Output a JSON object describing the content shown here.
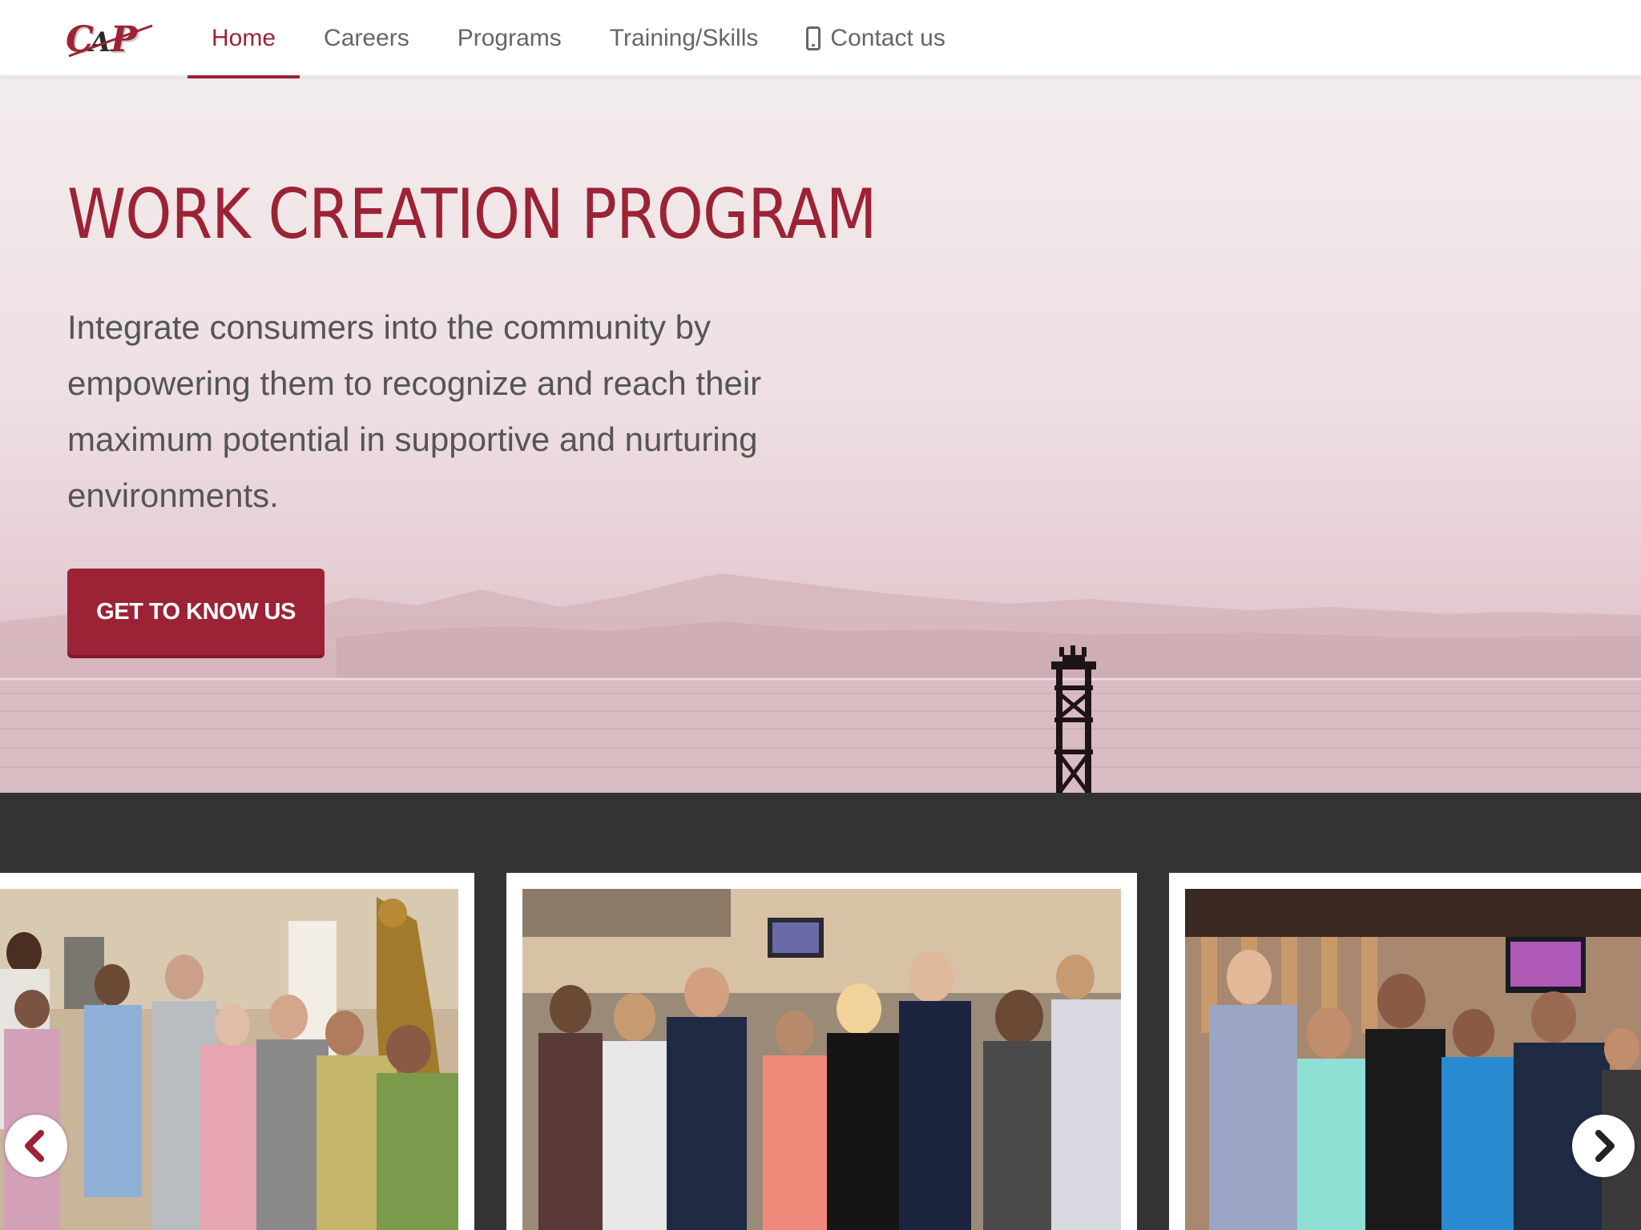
{
  "logo": {
    "text": "CAP",
    "icon": "cap-logo"
  },
  "nav": {
    "items": [
      {
        "label": "Home",
        "active": true
      },
      {
        "label": "Careers",
        "active": false
      },
      {
        "label": "Programs",
        "active": false
      },
      {
        "label": "Training/Skills",
        "active": false
      },
      {
        "label": "Contact us",
        "active": false,
        "icon": "mobile-phone-icon"
      }
    ]
  },
  "hero": {
    "title": "WORK CREATION PROGRAM",
    "description": "Integrate consumers into the community by empowering them to recognize and reach their maximum potential in supportive and nurturing environments.",
    "cta_label": "GET TO KNOW US"
  },
  "gallery": {
    "photos": [
      {
        "subject": "group-photo"
      },
      {
        "subject": "group-photo"
      },
      {
        "subject": "group-photo"
      }
    ],
    "prev_icon": "chevron-left-icon",
    "next_icon": "chevron-right-icon"
  },
  "colors": {
    "brand": "#9b2335",
    "nav_text": "#666666",
    "body_text": "#555555",
    "gallery_bg": "#333333"
  }
}
